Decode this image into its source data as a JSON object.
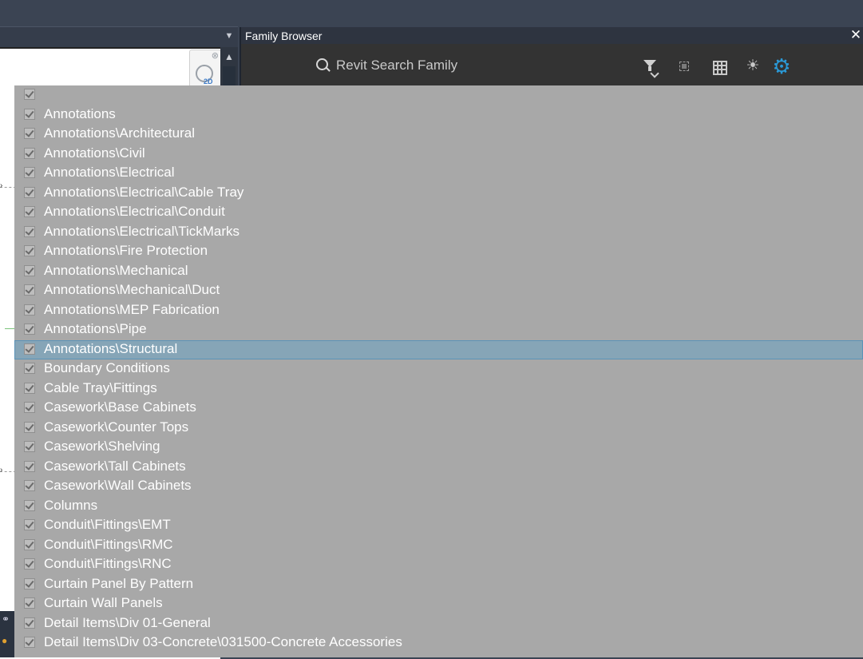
{
  "window": {
    "panel_title": "Family Browser",
    "close_glyph": "✕"
  },
  "viewcube": {
    "tag": "2D"
  },
  "toolbar": {
    "search_placeholder": "Revit Search Family",
    "icons": [
      "search-icon",
      "filter-icon",
      "select-icon",
      "grid-icon",
      "theme-icon",
      "settings-icon"
    ],
    "settings_color": "#2a9ad8"
  },
  "dropdown": {
    "selected_index": 13,
    "items": [
      "",
      "Annotations",
      "Annotations\\Architectural",
      "Annotations\\Civil",
      "Annotations\\Electrical",
      "Annotations\\Electrical\\Cable Tray",
      "Annotations\\Electrical\\Conduit",
      "Annotations\\Electrical\\TickMarks",
      "Annotations\\Fire Protection",
      "Annotations\\Mechanical",
      "Annotations\\Mechanical\\Duct",
      "Annotations\\MEP Fabrication",
      "Annotations\\Pipe",
      "Annotations\\Structural",
      "Boundary Conditions",
      "Cable Tray\\Fittings",
      "Casework\\Base Cabinets",
      "Casework\\Counter Tops",
      "Casework\\Shelving",
      "Casework\\Tall Cabinets",
      "Casework\\Wall Cabinets",
      "Columns",
      "Conduit\\Fittings\\EMT",
      "Conduit\\Fittings\\RMC",
      "Conduit\\Fittings\\RNC",
      "Curtain Panel By Pattern",
      "Curtain Wall Panels",
      "Detail Items\\Div 01-General",
      "Detail Items\\Div 03-Concrete\\031500-Concrete Accessories"
    ]
  }
}
